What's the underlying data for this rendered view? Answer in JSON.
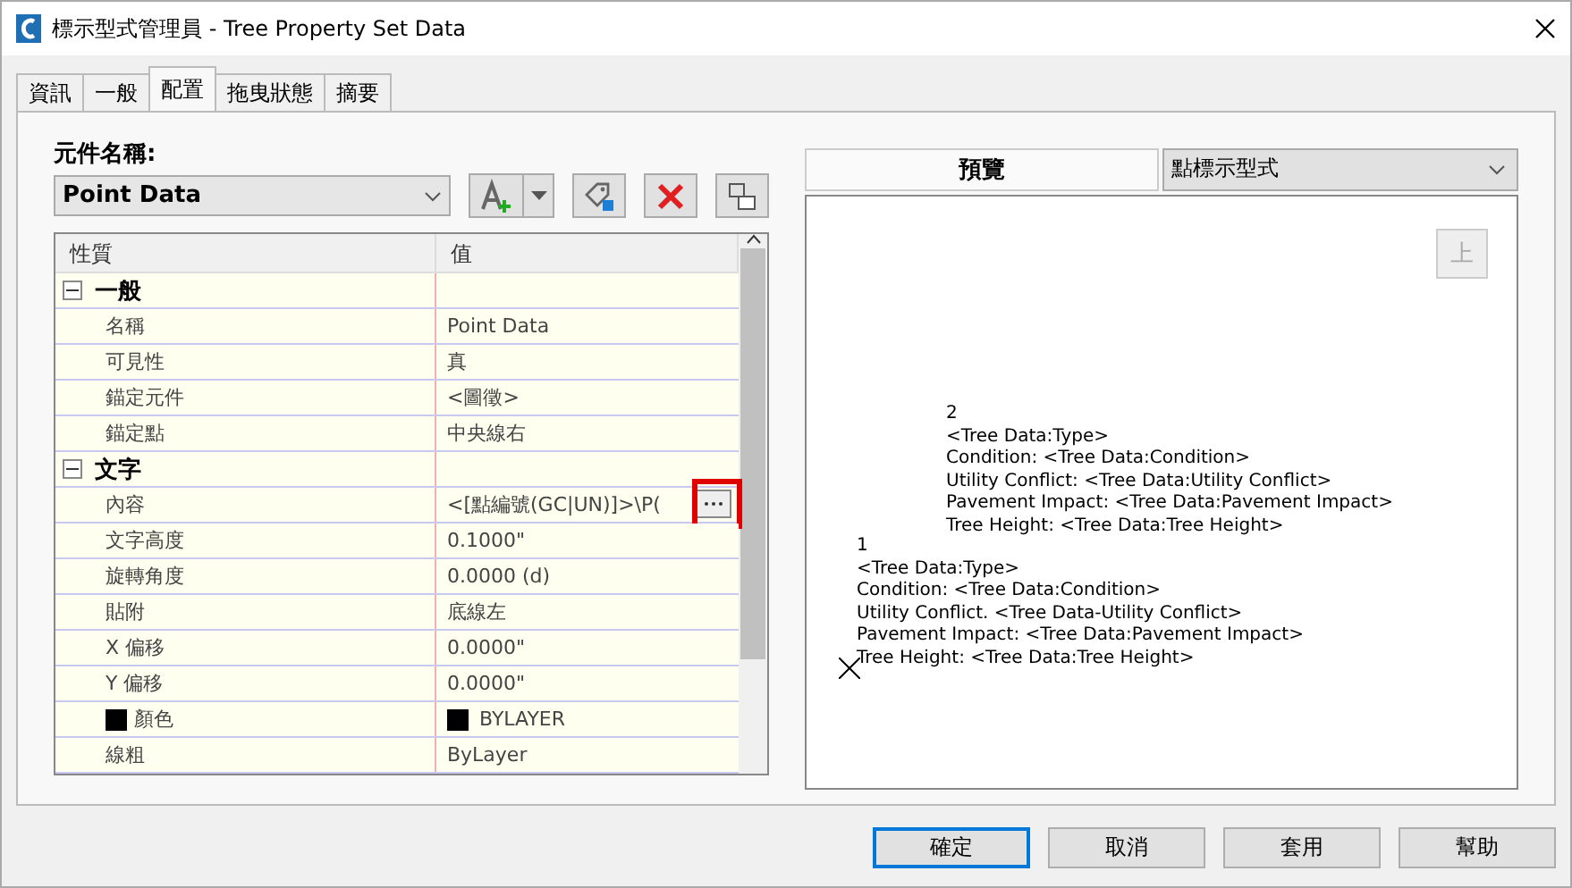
{
  "window": {
    "title": "標示型式管理員 - Tree Property Set Data"
  },
  "tabs": [
    {
      "label": "資訊",
      "selected": false
    },
    {
      "label": "一般",
      "selected": false
    },
    {
      "label": "配置",
      "selected": true
    },
    {
      "label": "拖曳狀態",
      "selected": false
    },
    {
      "label": "摘要",
      "selected": false
    }
  ],
  "component": {
    "label": "元件名稱:",
    "value": "Point Data"
  },
  "grid": {
    "columns": [
      "性質",
      "值"
    ],
    "rows": [
      {
        "kind": "category",
        "name": "一般",
        "expanded": true
      },
      {
        "kind": "property",
        "name": "名稱",
        "value": "Point Data"
      },
      {
        "kind": "property",
        "name": "可見性",
        "value": "真"
      },
      {
        "kind": "property",
        "name": "錨定元件",
        "value": "<圖徵>"
      },
      {
        "kind": "property",
        "name": "錨定點",
        "value": "中央線右"
      },
      {
        "kind": "category",
        "name": "文字",
        "expanded": true
      },
      {
        "kind": "property",
        "name": "內容",
        "value": "<[點編號(GC|UN)]>\\P(",
        "ellipsis": true
      },
      {
        "kind": "property",
        "name": "文字高度",
        "value": "0.1000\""
      },
      {
        "kind": "property",
        "name": "旋轉角度",
        "value": "0.0000 (d)"
      },
      {
        "kind": "property",
        "name": "貼附",
        "value": "底線左"
      },
      {
        "kind": "property",
        "name": "X 偏移",
        "value": "0.0000\""
      },
      {
        "kind": "property",
        "name": "Y 偏移",
        "value": "0.0000\""
      },
      {
        "kind": "property",
        "name": "顏色",
        "value": "BYLAYER",
        "color": "#000000"
      },
      {
        "kind": "property",
        "name": "線粗",
        "value": "ByLayer"
      }
    ]
  },
  "preview": {
    "title": "預覽",
    "style": "點標示型式",
    "up_button": "上",
    "labels": [
      {
        "number": "2",
        "lines": [
          "<Tree Data:Type>",
          "Condition: <Tree Data:Condition>",
          "Utility Conflict: <Tree Data:Utility Conflict>",
          "Pavement Impact: <Tree Data:Pavement Impact>",
          "Tree Height: <Tree Data:Tree Height>"
        ]
      },
      {
        "number": "1",
        "lines": [
          "<Tree Data:Type>",
          "Condition: <Tree Data:Condition>",
          "Utility Conflict. <Tree Data-Utility Conflict>",
          "Pavement Impact: <Tree Data:Pavement Impact>",
          "Tree Height: <Tree Data:Tree Height>"
        ]
      }
    ]
  },
  "buttons": [
    {
      "label": "確定",
      "default": true
    },
    {
      "label": "取消",
      "default": false
    },
    {
      "label": "套用",
      "default": false
    },
    {
      "label": "幫助",
      "default": false
    }
  ]
}
